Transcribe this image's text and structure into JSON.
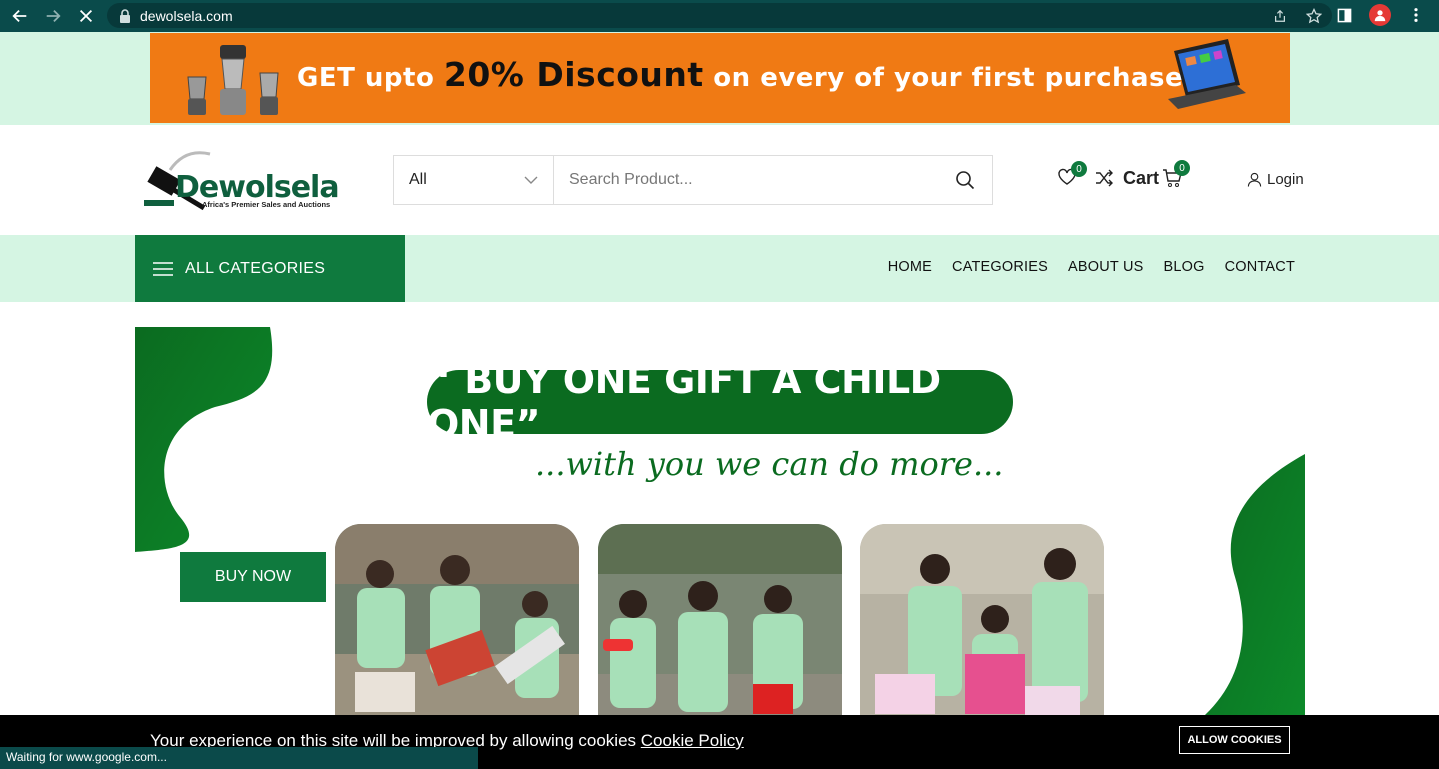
{
  "browser": {
    "url": "dewolsela.com",
    "status_text": "Waiting for www.google.com..."
  },
  "promo": {
    "prefix": "GET upto",
    "highlight": "20% Discount",
    "suffix": "on every of your first purchase"
  },
  "header": {
    "logo_name": "Dewolsela",
    "logo_tagline": "Africa's Premier Sales and Auctions",
    "search": {
      "category_selected": "All",
      "placeholder": "Search Product..."
    },
    "wishlist_count": "0",
    "cart_label": "Cart",
    "cart_count": "0",
    "login_label": "Login"
  },
  "nav": {
    "all_categories": "ALL CATEGORIES",
    "items": [
      "HOME",
      "CATEGORIES",
      "ABOUT US",
      "BLOG",
      "CONTACT"
    ]
  },
  "hero": {
    "headline": "“ BUY ONE GIFT A CHILD ONE”",
    "subline": "...with you we can do more...",
    "cta": "BUY NOW"
  },
  "cookie": {
    "message": "Your experience on this site will be improved by allowing cookies",
    "policy_link": "Cookie Policy",
    "allow_button": "ALLOW COOKIES"
  },
  "colors": {
    "brand_green": "#0f7a3e",
    "mint": "#d5f5e3",
    "promo_orange": "#f07a14",
    "chrome_teal": "#0a4b4b"
  }
}
